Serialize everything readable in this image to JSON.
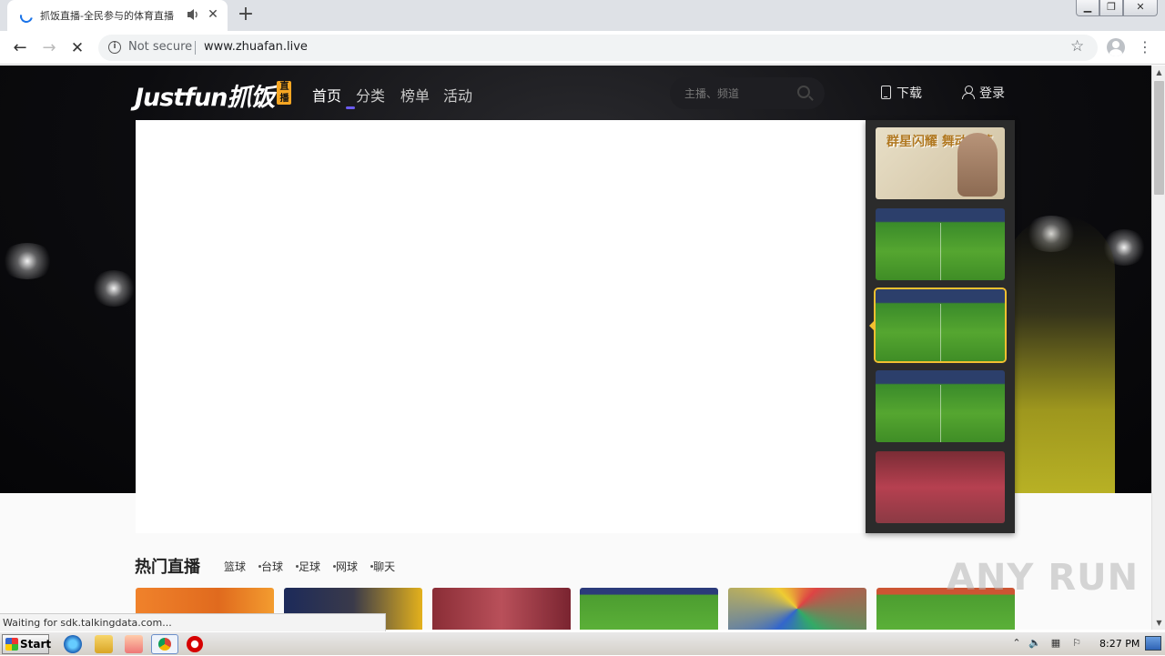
{
  "browser": {
    "tab_title": "抓饭直播-全民参与的体育直播",
    "address": {
      "security_label": "Not secure",
      "url": "www.zhuafan.live"
    },
    "status_text": "Waiting for sdk.talkingdata.com..."
  },
  "site": {
    "logo_text": "Justfun抓饭",
    "logo_badge": "直播",
    "nav": [
      {
        "label": "首页",
        "active": true
      },
      {
        "label": "分类"
      },
      {
        "label": "榜单"
      },
      {
        "label": "活动"
      }
    ],
    "search_placeholder": "主播、频道",
    "download_label": "下载",
    "login_label": "登录",
    "promo_text": "群星闪耀 舞动绿茵",
    "hot_live": {
      "title": "热门直播",
      "categories": [
        "篮球",
        "台球",
        "足球",
        "网球",
        "聊天"
      ]
    }
  },
  "watermark": "ANY RUN",
  "taskbar": {
    "start_label": "Start",
    "clock": "8:27 PM"
  },
  "colors": {
    "accent": "#6c5cf0",
    "thumb_highlight": "#f2c030",
    "hero_bg": "#0c0c0f"
  }
}
